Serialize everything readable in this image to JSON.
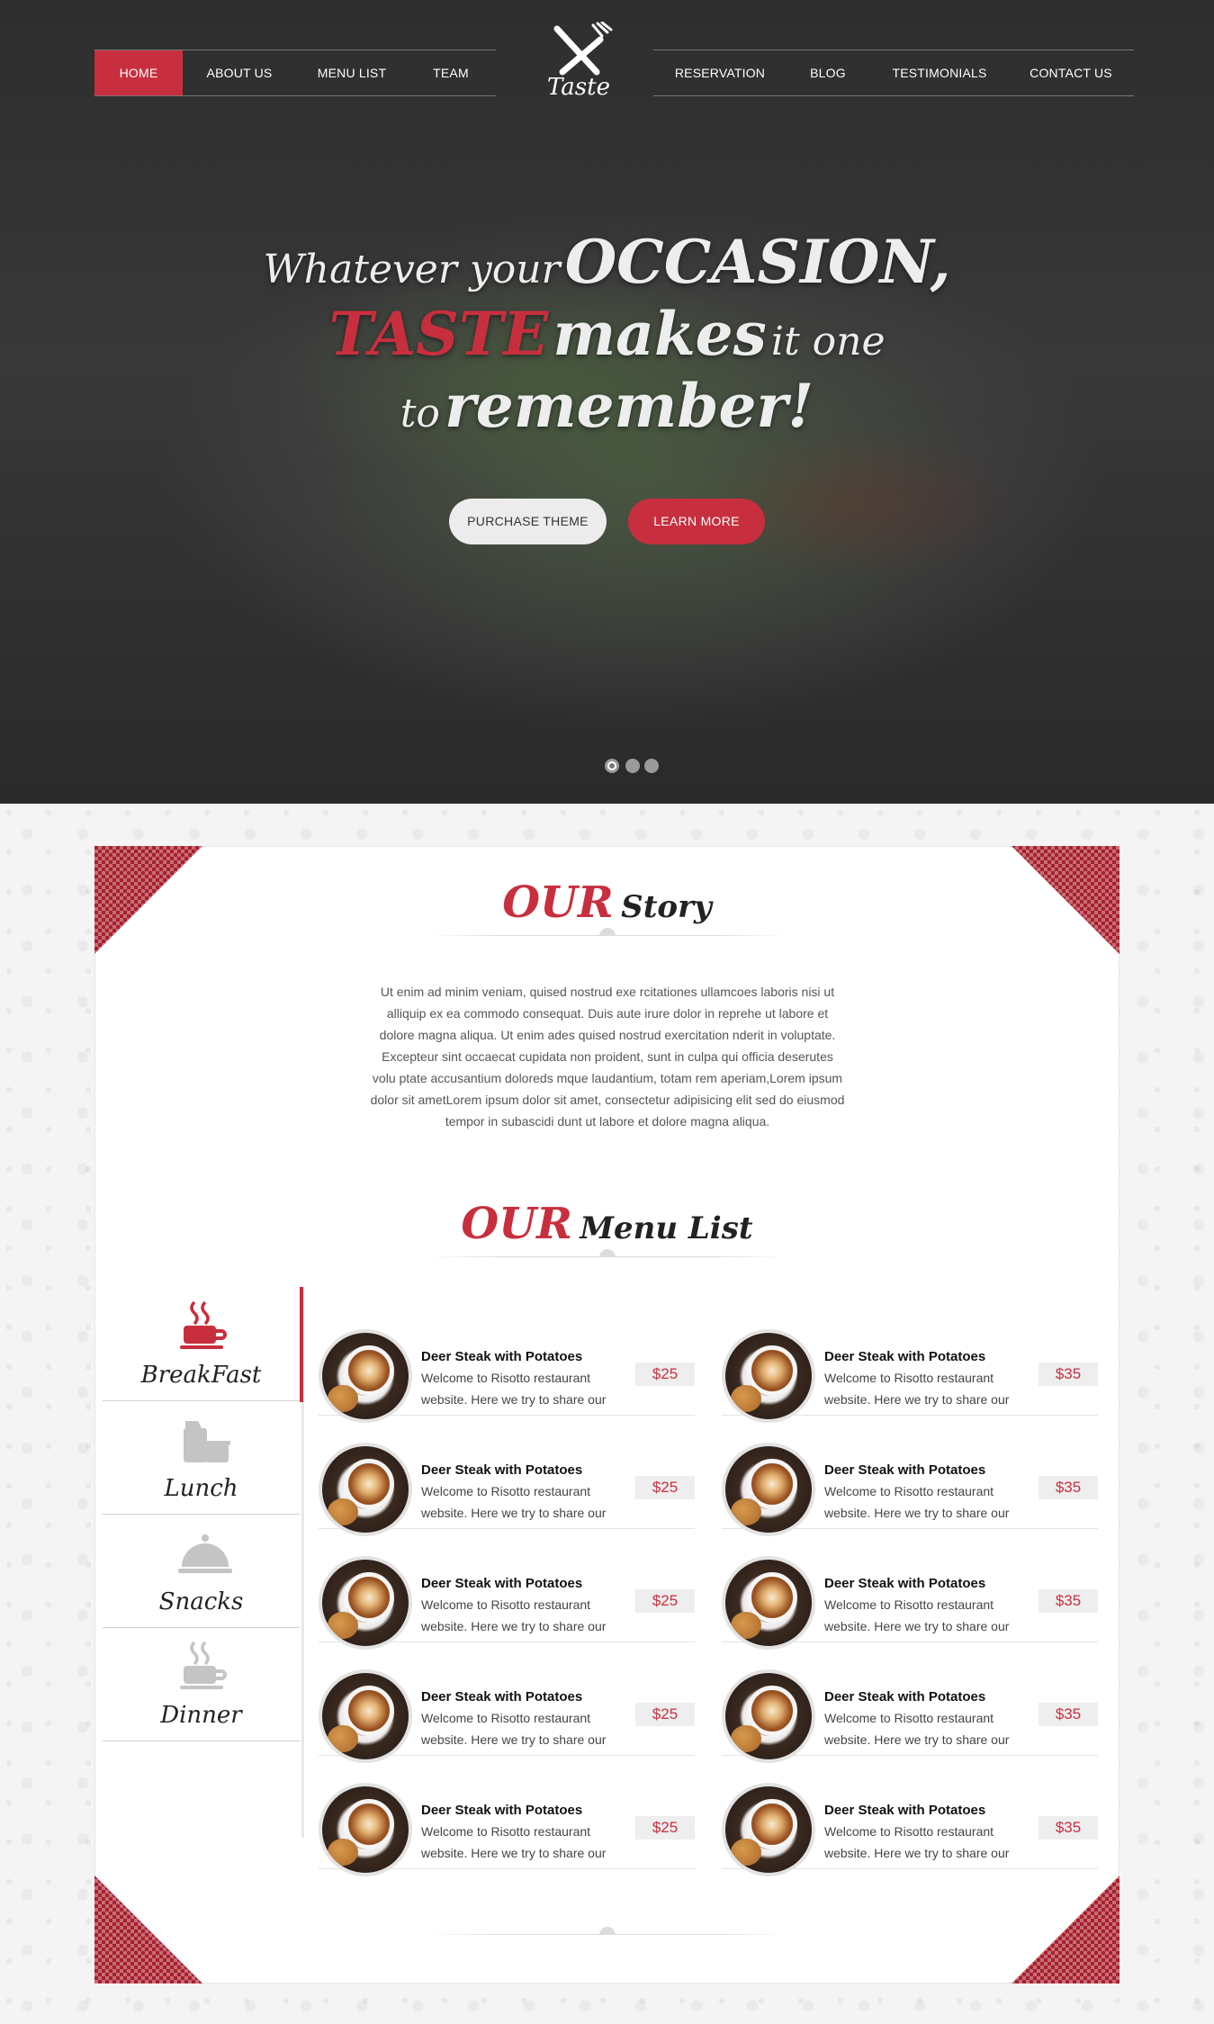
{
  "nav": {
    "left": [
      "HOME",
      "ABOUT US",
      "MENU LIST",
      "TEAM"
    ],
    "right": [
      "RESERVATION",
      "BLOG",
      "TESTIMONIALS",
      "CONTACT US"
    ],
    "active": "HOME"
  },
  "logo": {
    "text": "Taste",
    "icon": "fork-knife-icon"
  },
  "hero": {
    "line1_a": "Whatever your",
    "line1_b": "OCCASION,",
    "line2_a": "TASTE",
    "line2_b": "makes",
    "line2_c": "it one",
    "line3_a": "to",
    "line3_b": "remember!",
    "purchase_button": "PURCHASE THEME",
    "learn_button": "LEARN MORE",
    "slides": 3,
    "active_slide": 1
  },
  "story": {
    "title_red": "OUR",
    "title_dark": "Story",
    "text": "Ut enim ad minim veniam, quised nostrud exe rcitationes ullamcoes laboris nisi ut alliquip ex ea commodo consequat. Duis aute irure dolor in reprehe ut labore et dolore magna aliqua. Ut enim ades quised nostrud exercitation nderit in voluptate. Excepteur sint occaecat cupidata non proident, sunt in culpa qui officia deserutes volu ptate accusantium doloreds mque laudantium, totam rem aperiam,Lorem ipsum dolor sit ametLorem ipsum dolor sit amet, consectetur adipisicing elit sed do eiusmod tempor in subascidi dunt ut labore et dolore magna aliqua."
  },
  "menu": {
    "title_red": "OUR",
    "title_dark": "Menu List",
    "tabs": [
      {
        "label": "BreakFast",
        "icon": "coffee-cup-icon",
        "active": true
      },
      {
        "label": "Lunch",
        "icon": "takeaway-icon",
        "active": false
      },
      {
        "label": "Snacks",
        "icon": "cloche-icon",
        "active": false
      },
      {
        "label": "Dinner",
        "icon": "coffee-cup-icon",
        "active": false
      }
    ],
    "items": [
      {
        "title": "Deer Steak with Potatoes",
        "desc": "Welcome to Risotto restaurant website. Here we try to share our",
        "price": "$25"
      },
      {
        "title": "Deer Steak with Potatoes",
        "desc": "Welcome to Risotto restaurant website. Here we try to share our",
        "price": "$35"
      },
      {
        "title": "Deer Steak with Potatoes",
        "desc": "Welcome to Risotto restaurant website. Here we try to share our",
        "price": "$25"
      },
      {
        "title": "Deer Steak with Potatoes",
        "desc": "Welcome to Risotto restaurant website. Here we try to share our",
        "price": "$35"
      },
      {
        "title": "Deer Steak with Potatoes",
        "desc": "Welcome to Risotto restaurant website. Here we try to share our",
        "price": "$25"
      },
      {
        "title": "Deer Steak with Potatoes",
        "desc": "Welcome to Risotto restaurant website. Here we try to share our",
        "price": "$35"
      },
      {
        "title": "Deer Steak with Potatoes",
        "desc": "Welcome to Risotto restaurant website. Here we try to share our",
        "price": "$25"
      },
      {
        "title": "Deer Steak with Potatoes",
        "desc": "Welcome to Risotto restaurant website. Here we try to share our",
        "price": "$35"
      },
      {
        "title": "Deer Steak with Potatoes",
        "desc": "Welcome to Risotto restaurant website. Here we try to share our",
        "price": "$25"
      },
      {
        "title": "Deer Steak with Potatoes",
        "desc": "Welcome to Risotto restaurant website. Here we try to share our",
        "price": "$35"
      }
    ]
  },
  "colors": {
    "accent": "#c82f3e",
    "dark": "#2e2e2e",
    "tab_inactive": "#c4c4c4"
  }
}
